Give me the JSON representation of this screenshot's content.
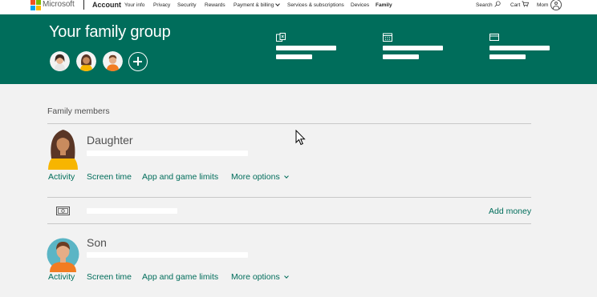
{
  "topnav": {
    "brand": "Microsoft",
    "section": "Account",
    "links": [
      "Your info",
      "Privacy",
      "Security",
      "Rewards",
      "Payment & billing",
      "Services & subscriptions",
      "Devices",
      "Family"
    ],
    "active_link": "Family",
    "search_label": "Search",
    "cart_label": "Cart",
    "user_label": "Mom"
  },
  "banner": {
    "title": "Your family group",
    "background_color": "#006d5b",
    "feature_icons": [
      "xbox-store-icon",
      "calendar-icon",
      "card-icon"
    ]
  },
  "family": {
    "section_title": "Family members",
    "members": [
      {
        "name": "Daughter",
        "actions": [
          "Activity",
          "Screen time",
          "App and game limits",
          "More options"
        ]
      },
      {
        "name": "Son",
        "actions": [
          "Activity",
          "Screen time",
          "App and game limits",
          "More options"
        ]
      }
    ],
    "money_action": "Add money"
  },
  "colors": {
    "accent": "#006d5b",
    "page_bg": "#f2f2f2",
    "ms_logo": [
      "#f25022",
      "#7fba00",
      "#00a4ef",
      "#ffb900"
    ]
  }
}
